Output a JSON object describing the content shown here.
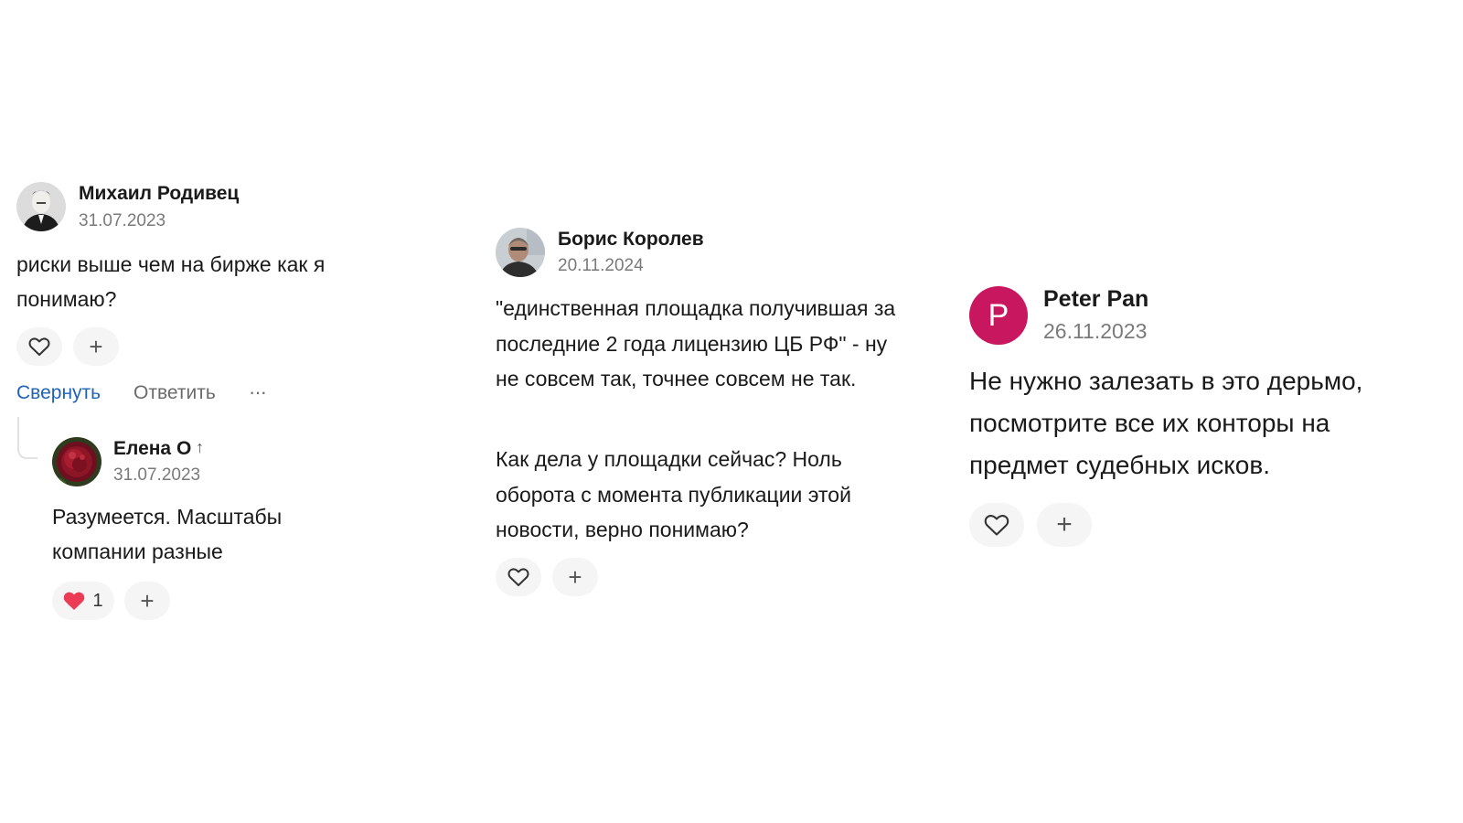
{
  "comments": [
    {
      "author": "Михаил Родивец",
      "date": "31.07.2023",
      "text": "риски выше чем на бирже как я понимаю?",
      "actions": {
        "collapse": "Свернуть",
        "reply": "Ответить",
        "more": "···"
      },
      "avatar_icon": "user-photo-avatar",
      "reply": {
        "author": "Елена О",
        "date": "31.07.2023",
        "text": "Разумеется. Масштабы компании разные",
        "likes": "1",
        "liked": true,
        "avatar_icon": "flower-photo-avatar"
      }
    },
    {
      "author": "Борис Королев",
      "date": "20.11.2024",
      "paragraphs": [
        "\"единственная площадка получившая за последние 2 года лицензию ЦБ РФ\" - ну не совсем так, точнее совсем не так.",
        "Как дела у площадки сейчас? Ноль оборота с момента публикации этой новости, верно понимаю?"
      ],
      "avatar_icon": "user-photo-avatar"
    },
    {
      "author": "Peter Pan",
      "date": "26.11.2023",
      "avatar_letter": "P",
      "text": "Не нужно залезать в это дерьмо, посмотрите все их конторы на предмет судебных исков."
    }
  ],
  "colors": {
    "link_blue": "#1f63b6",
    "heart_red": "#ec3b54",
    "avatar_pink": "#c8175f",
    "pill_bg": "#f5f5f5",
    "muted_text": "#7a7a7a"
  },
  "icons": {
    "like": "heart-icon",
    "add": "plus-icon",
    "reply_marker": "arrow-up-icon"
  }
}
